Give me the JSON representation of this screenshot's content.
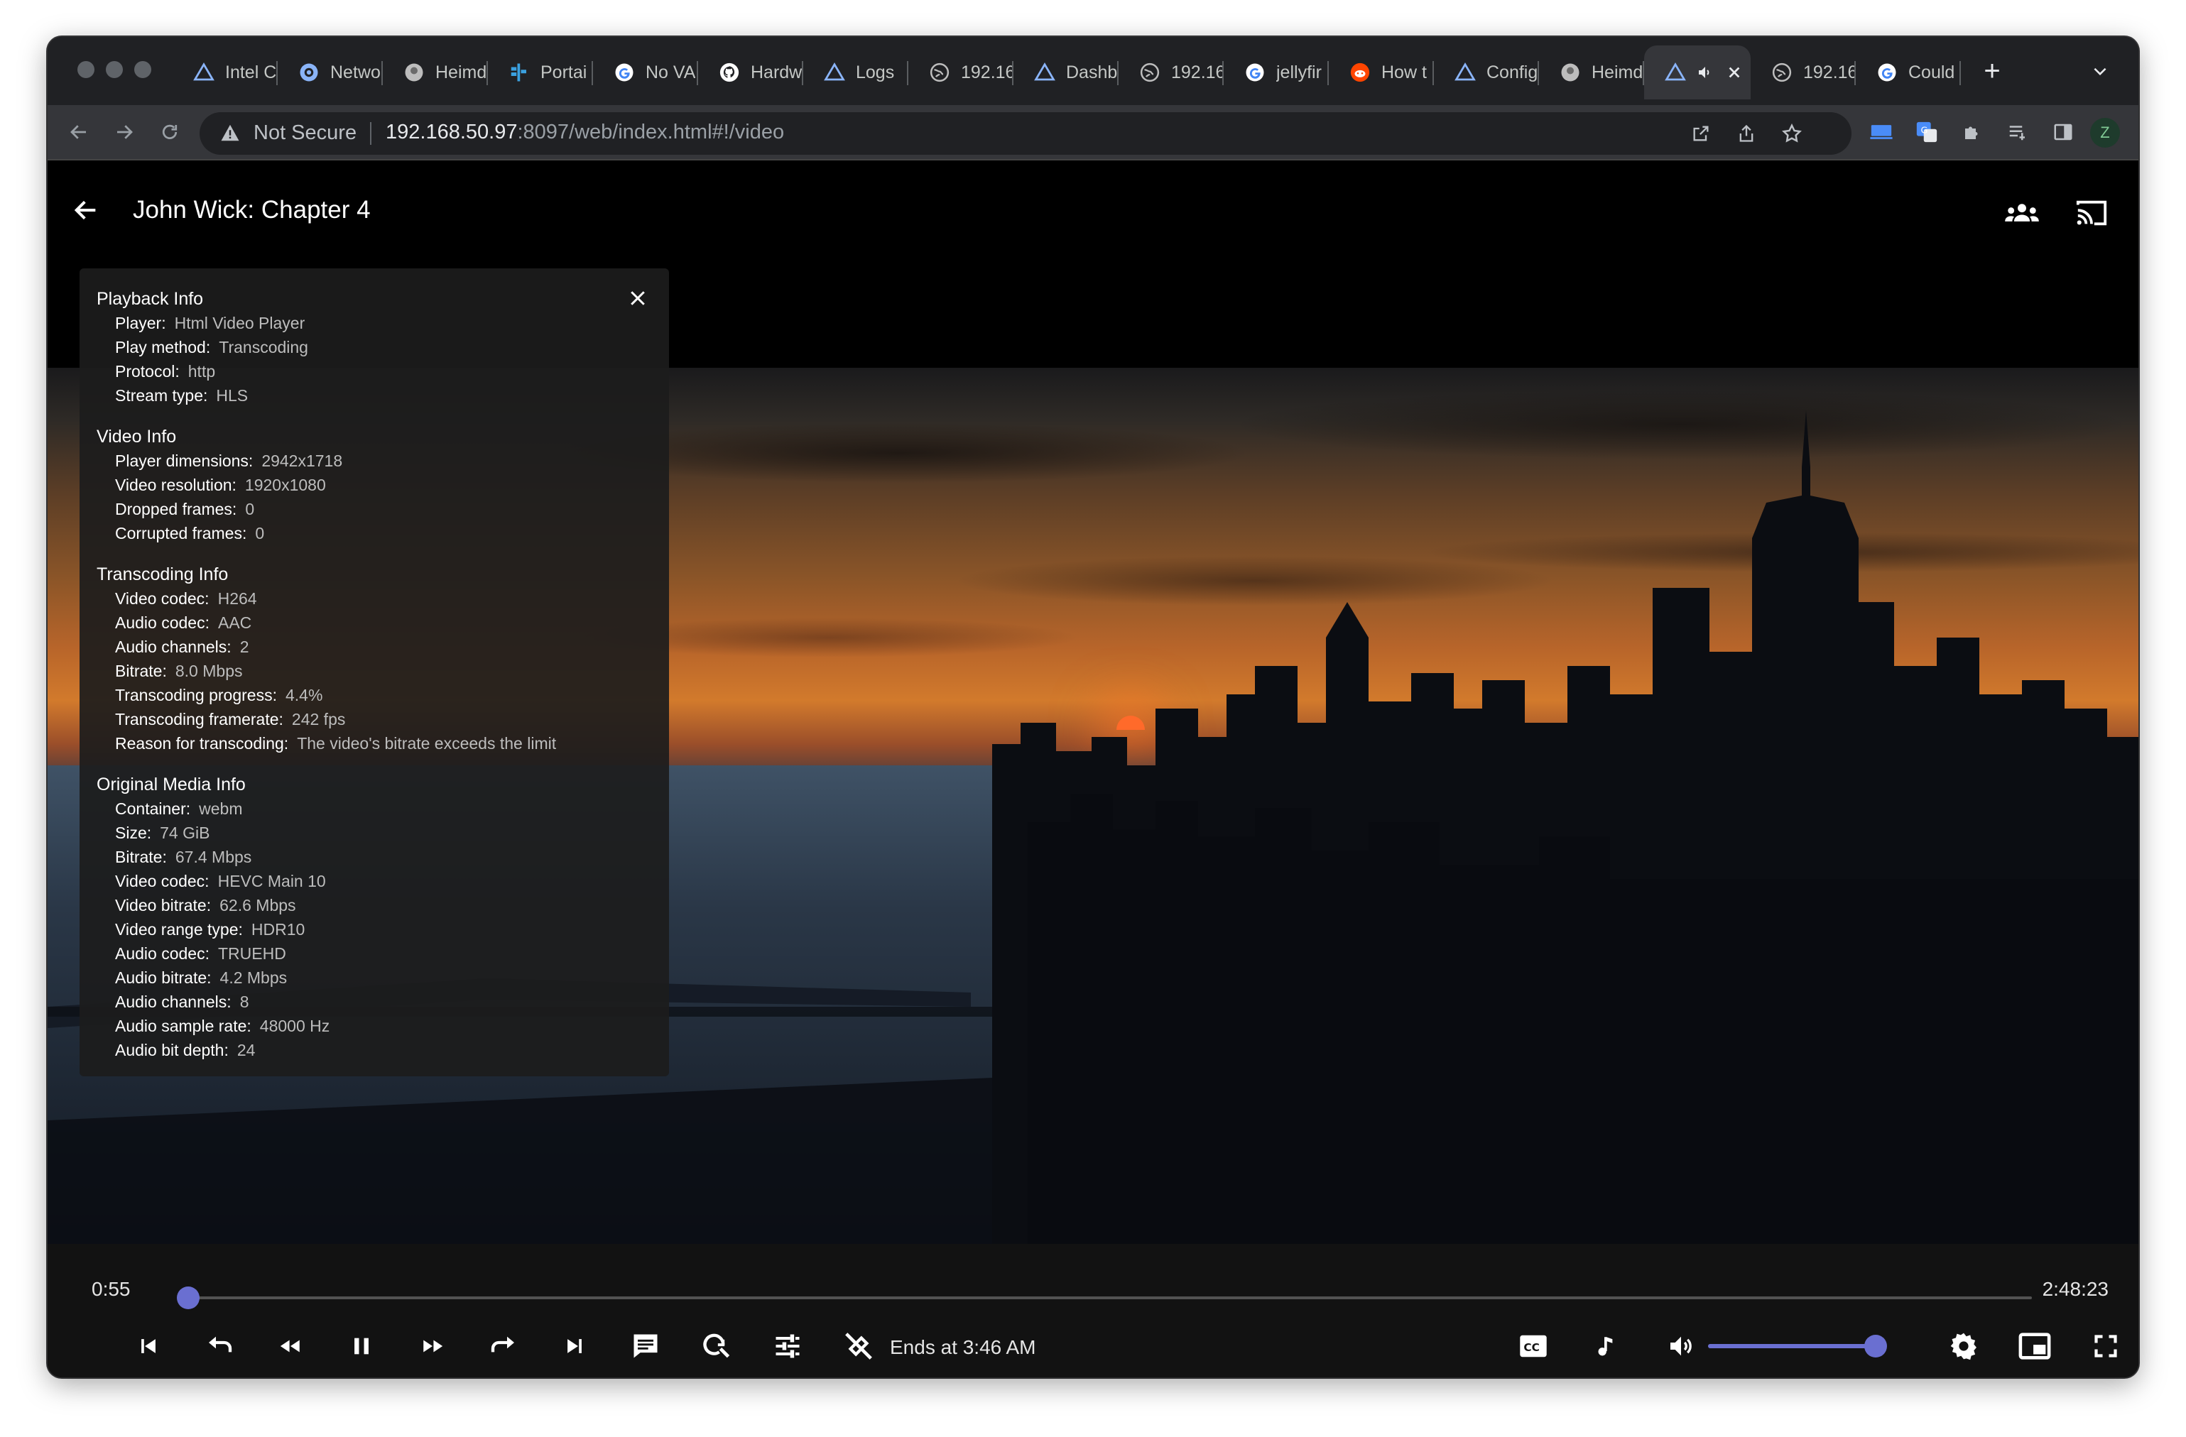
{
  "browser": {
    "tabs": [
      {
        "title": "Intel C",
        "icon": "arc-triangle-icon",
        "color": "#8ab4f8"
      },
      {
        "title": "Netwo",
        "icon": "network-icon",
        "color": "#8ab4f8"
      },
      {
        "title": "Heimd",
        "icon": "heimdall-icon",
        "color": "#bdbdbd"
      },
      {
        "title": "Portai",
        "icon": "portainer-icon",
        "color": "#3ba1e0"
      },
      {
        "title": "No VA",
        "icon": "google-icon",
        "color": "#ffffff"
      },
      {
        "title": "Hardw",
        "icon": "github-icon",
        "color": "#ffffff"
      },
      {
        "title": "Logs",
        "icon": "arc-triangle-icon",
        "color": "#8ab4f8"
      },
      {
        "title": "192.16",
        "icon": "globe-icon",
        "color": "#bdbdbd"
      },
      {
        "title": "Dashb",
        "icon": "arc-triangle-icon",
        "color": "#8ab4f8"
      },
      {
        "title": "192.16",
        "icon": "globe-icon",
        "color": "#bdbdbd"
      },
      {
        "title": "jellyfir",
        "icon": "google-icon",
        "color": "#ffffff"
      },
      {
        "title": "How t",
        "icon": "reddit-icon",
        "color": "#ff4500"
      },
      {
        "title": "Config",
        "icon": "arc-triangle-icon",
        "color": "#8ab4f8"
      },
      {
        "title": "Heimd",
        "icon": "heimdall-icon",
        "color": "#bdbdbd"
      },
      {
        "title": "",
        "icon": "arc-triangle-icon",
        "color": "#8ab4f8",
        "active": true
      },
      {
        "title": "192.16",
        "icon": "globe-icon",
        "color": "#bdbdbd"
      },
      {
        "title": "Could",
        "icon": "google-icon",
        "color": "#ffffff"
      }
    ],
    "newtab_label": "+",
    "security_label": "Not Secure",
    "url_host": "192.168.50.97",
    "url_rest": ":8097/web/index.html#!/video",
    "profile_initial": "Z"
  },
  "player": {
    "title": "John Wick: Chapter 4",
    "current_time": "0:55",
    "duration": "2:48:23",
    "progress_fraction": 0.0055,
    "ends_at": "Ends at 3:46 AM",
    "volume_fraction": 1.0,
    "accent_color": "#6a6fd1"
  },
  "playback_info": {
    "sections": [
      {
        "title": "Playback Info",
        "rows": [
          {
            "label": "Player:",
            "value": "Html Video Player"
          },
          {
            "label": "Play method:",
            "value": "Transcoding"
          },
          {
            "label": "Protocol:",
            "value": "http"
          },
          {
            "label": "Stream type:",
            "value": "HLS"
          }
        ]
      },
      {
        "title": "Video Info",
        "rows": [
          {
            "label": "Player dimensions:",
            "value": "2942x1718"
          },
          {
            "label": "Video resolution:",
            "value": "1920x1080"
          },
          {
            "label": "Dropped frames:",
            "value": "0"
          },
          {
            "label": "Corrupted frames:",
            "value": "0"
          }
        ]
      },
      {
        "title": "Transcoding Info",
        "rows": [
          {
            "label": "Video codec:",
            "value": "H264"
          },
          {
            "label": "Audio codec:",
            "value": "AAC"
          },
          {
            "label": "Audio channels:",
            "value": "2"
          },
          {
            "label": "Bitrate:",
            "value": "8.0 Mbps"
          },
          {
            "label": "Transcoding progress:",
            "value": "4.4%"
          },
          {
            "label": "Transcoding framerate:",
            "value": "242 fps"
          },
          {
            "label": "Reason for transcoding:",
            "value": "The video's bitrate exceeds the limit"
          }
        ]
      },
      {
        "title": "Original Media Info",
        "rows": [
          {
            "label": "Container:",
            "value": "webm"
          },
          {
            "label": "Size:",
            "value": "74 GiB"
          },
          {
            "label": "Bitrate:",
            "value": "67.4 Mbps"
          },
          {
            "label": "Video codec:",
            "value": "HEVC Main 10"
          },
          {
            "label": "Video bitrate:",
            "value": "62.6 Mbps"
          },
          {
            "label": "Video range type:",
            "value": "HDR10"
          },
          {
            "label": "Audio codec:",
            "value": "TRUEHD"
          },
          {
            "label": "Audio bitrate:",
            "value": "4.2 Mbps"
          },
          {
            "label": "Audio channels:",
            "value": "8"
          },
          {
            "label": "Audio sample rate:",
            "value": "48000 Hz"
          },
          {
            "label": "Audio bit depth:",
            "value": "24"
          }
        ]
      }
    ]
  }
}
